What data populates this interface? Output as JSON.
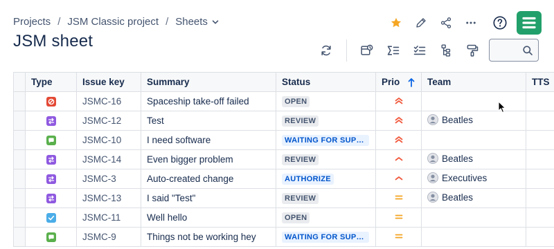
{
  "breadcrumb": {
    "items": [
      "Projects",
      "JSM Classic project",
      "Sheets"
    ],
    "separator": "/"
  },
  "page": {
    "title": "JSM sheet"
  },
  "top_actions": [
    "star-icon",
    "edit-icon",
    "share-icon",
    "more-icon",
    "help-icon",
    "app-logo"
  ],
  "toolbar": [
    "refresh-icon",
    "issue-view-icon",
    "sum-icon",
    "checklist-icon",
    "hierarchy-icon",
    "format-paint-icon"
  ],
  "search": {
    "value": "",
    "placeholder": ""
  },
  "table": {
    "columns": [
      "Type",
      "Issue key",
      "Summary",
      "Status",
      "Prio",
      "Team",
      "TTS"
    ],
    "sort": {
      "column": "Prio",
      "direction": "ascending"
    },
    "rows": [
      {
        "type": "incident",
        "key": "JSMC-16",
        "summary": "Spaceship take-off failed",
        "status": "OPEN",
        "status_style": "gray",
        "priority": "highest",
        "team": ""
      },
      {
        "type": "change",
        "key": "JSMC-12",
        "summary": "Test",
        "status": "REVIEW",
        "status_style": "gray",
        "priority": "highest",
        "team": "Beatles"
      },
      {
        "type": "service-request",
        "key": "JSMC-10",
        "summary": "I need software",
        "status": "WAITING FOR SUPPORT",
        "status_style": "blue",
        "priority": "highest",
        "team": ""
      },
      {
        "type": "change",
        "key": "JSMC-14",
        "summary": "Even bigger problem",
        "status": "REVIEW",
        "status_style": "gray",
        "priority": "high",
        "team": "Beatles"
      },
      {
        "type": "change",
        "key": "JSMC-3",
        "summary": "Auto-created change",
        "status": "AUTHORIZE",
        "status_style": "blue",
        "priority": "high",
        "team": "Executives"
      },
      {
        "type": "change",
        "key": "JSMC-13",
        "summary": "I said \"Test\"",
        "status": "REVIEW",
        "status_style": "gray",
        "priority": "medium",
        "team": "Beatles"
      },
      {
        "type": "task",
        "key": "JSMC-11",
        "summary": "Well hello",
        "status": "OPEN",
        "status_style": "gray",
        "priority": "medium",
        "team": ""
      },
      {
        "type": "service-request",
        "key": "JSMC-9",
        "summary": "Things not be working hey",
        "status": "WAITING FOR SUPPORT",
        "status_style": "blue",
        "priority": "medium",
        "team": ""
      }
    ]
  },
  "colors": {
    "incident": "#e34935",
    "change": "#8f59e0",
    "service_request": "#5ab04c",
    "task": "#4bade8",
    "priority_high": "#f15b3f",
    "priority_medium": "#f4a21f",
    "star": "#f5a623",
    "logo": "#22a06b",
    "lozenge_blue_text": "#0055cc"
  }
}
